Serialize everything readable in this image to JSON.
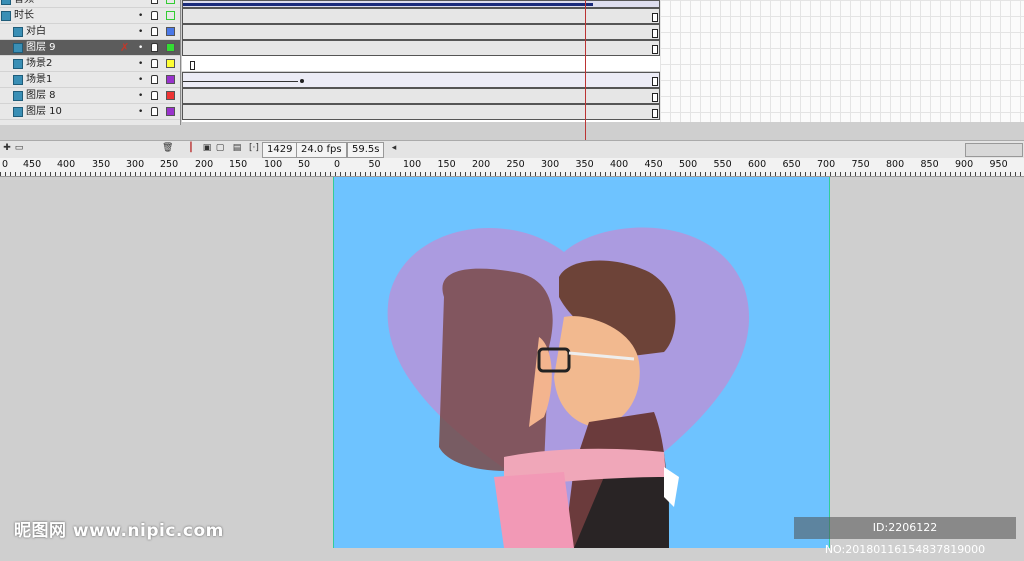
{
  "layers": [
    {
      "name": "音频",
      "swatch": "#f2f2f2",
      "outlined": true
    },
    {
      "name": "时长",
      "swatch": "#ffffff",
      "outlined": true
    },
    {
      "name": "对白",
      "swatch": "#4a78e8",
      "outlined": false
    },
    {
      "name": "图层 9",
      "swatch": "#33dd33",
      "outlined": false,
      "selected": true
    },
    {
      "name": "场景2",
      "swatch": "#ffff33",
      "outlined": false
    },
    {
      "name": "场景1",
      "swatch": "#9933cc",
      "outlined": false
    },
    {
      "name": "图层 8",
      "swatch": "#ee3333",
      "outlined": false
    },
    {
      "name": "图层 10",
      "swatch": "#9933cc",
      "outlined": false
    }
  ],
  "status": {
    "frame": "1429",
    "fps": "24.0 fps",
    "time": "59.5s"
  },
  "ruler": {
    "left_labels": [
      "0",
      "450",
      "400",
      "350",
      "300",
      "250",
      "200",
      "150",
      "100",
      "50"
    ],
    "right_labels": [
      "0",
      "50",
      "100",
      "150",
      "200",
      "250",
      "300",
      "350",
      "400",
      "450",
      "500",
      "550",
      "600",
      "650",
      "700",
      "750",
      "800",
      "850",
      "900",
      "950"
    ]
  },
  "watermark": {
    "text": "昵图网 www.nipic.com",
    "id": "ID:2206122 NO:20180116154837819000"
  },
  "colors": {
    "stage": "#6ec3ff",
    "heart": "#c08ed6",
    "selected_layer": "#5c5c5c"
  }
}
